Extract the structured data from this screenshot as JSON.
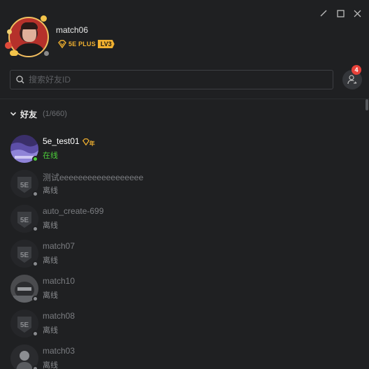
{
  "window": {
    "controls": [
      "minimize",
      "maximize",
      "close"
    ]
  },
  "profile": {
    "username": "match06",
    "plus_label": "5E PLUS",
    "level": "LV3",
    "status_color": "#8a8a8a"
  },
  "search": {
    "placeholder": "搜索好友ID",
    "value": ""
  },
  "add_friend": {
    "notification_count": "4"
  },
  "group": {
    "name": "好友",
    "count": "(1/660)",
    "expanded": true
  },
  "friends": [
    {
      "name": "5e_test01",
      "status": "在线",
      "online": true,
      "avatar": "custom",
      "badge": "年"
    },
    {
      "name": "测试eeeeeeeeeeeeeeeeee",
      "status": "离线",
      "online": false,
      "avatar": "5e-logo"
    },
    {
      "name": "auto_create-699",
      "status": "离线",
      "online": false,
      "avatar": "5e-logo"
    },
    {
      "name": "match07",
      "status": "离线",
      "online": false,
      "avatar": "5e-logo"
    },
    {
      "name": "match10",
      "status": "离线",
      "online": false,
      "avatar": "photo-helmet"
    },
    {
      "name": "match08",
      "status": "离线",
      "online": false,
      "avatar": "5e-logo"
    },
    {
      "name": "match03",
      "status": "离线",
      "online": false,
      "avatar": "photo-person"
    }
  ],
  "colors": {
    "online": "#4ccf3a",
    "offline_dot": "#8a8c90",
    "accent_gold": "#f0b030",
    "notification": "#e8423a"
  }
}
